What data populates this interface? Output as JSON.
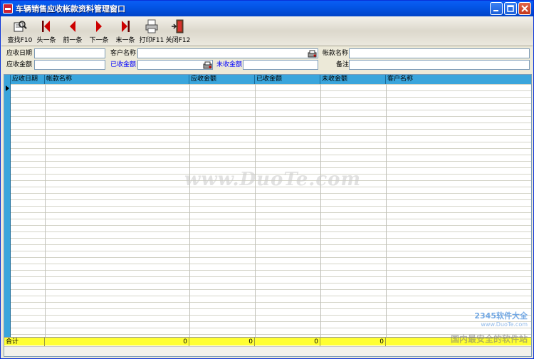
{
  "window": {
    "title": "车辆销售应收帐款资料管理窗口"
  },
  "toolbar": {
    "items": [
      {
        "label": "查找F10",
        "icon": "search-icon"
      },
      {
        "label": "头一条",
        "icon": "first-record-icon"
      },
      {
        "label": "前一条",
        "icon": "prev-record-icon"
      },
      {
        "label": "下一条",
        "icon": "next-record-icon"
      },
      {
        "label": "末一条",
        "icon": "last-record-icon"
      },
      {
        "label": "打印F11",
        "icon": "printer-icon"
      },
      {
        "label": "关闭F12",
        "icon": "exit-door-icon"
      }
    ]
  },
  "form": {
    "receivable_date_label": "应收日期",
    "customer_name_label": "客户名称",
    "account_name_label": "帐款名称",
    "receivable_amount_label": "应收金额",
    "received_amount_label": "已收金额",
    "unreceived_amount_label": "未收金额",
    "remark_label": "备注"
  },
  "grid": {
    "columns": [
      "应收日期",
      "帐款名称",
      "应收金额",
      "已收金额",
      "未收金额",
      "客户名称"
    ],
    "footer": {
      "label": "合计",
      "receivable_total": "0",
      "received_total": "0",
      "unreceived_total": "0",
      "customer_total": "0"
    }
  },
  "watermarks": {
    "center": "www.DuoTe.com",
    "logo_line1": "2345软件大全",
    "logo_line2": "www.DuoTe.com",
    "logo_line3": "国内最安全的软件站"
  },
  "colors": {
    "title_bar": "#0355e6",
    "grid_header": "#3aa5dc",
    "footer_row": "#ffff33",
    "blue_label": "#0000ff"
  }
}
